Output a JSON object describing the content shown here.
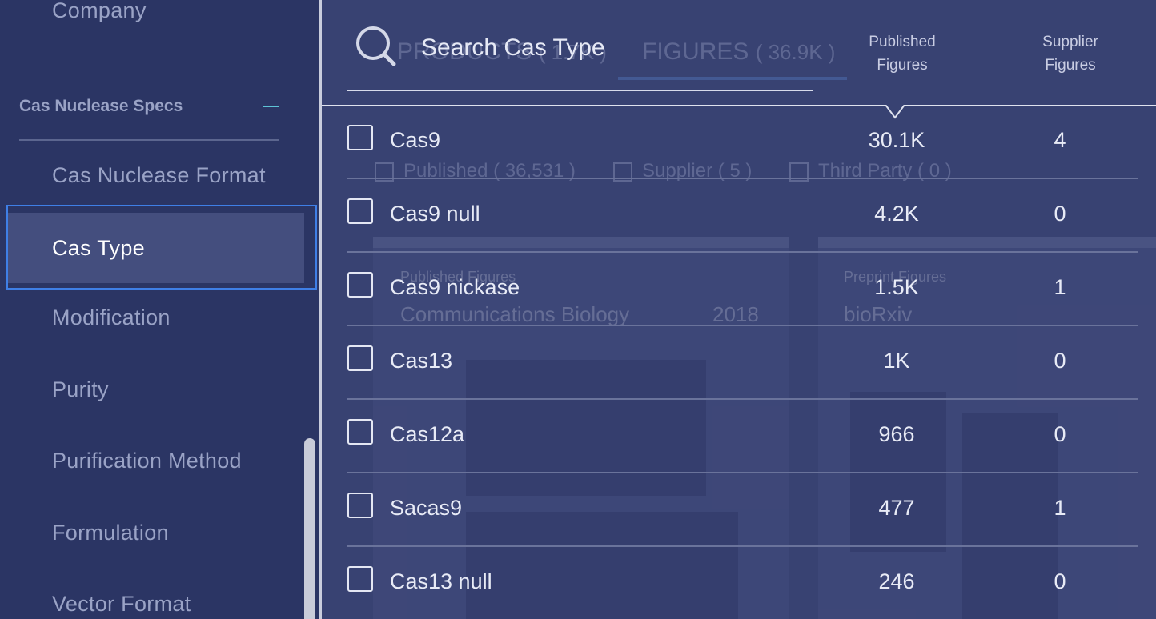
{
  "sidebar": {
    "company_label": "Company",
    "section_title": "Cas Nuclease Specs",
    "items": [
      {
        "label": "Cas Nuclease Format"
      },
      {
        "label": "Cas Type"
      },
      {
        "label": "Modification"
      },
      {
        "label": "Purity"
      },
      {
        "label": "Purification Method"
      },
      {
        "label": "Formulation"
      },
      {
        "label": "Vector Format"
      }
    ]
  },
  "search": {
    "placeholder": "Search Cas Type",
    "published_header_line1": "Published",
    "published_header_line2": "Figures",
    "supplier_header_line1": "Supplier",
    "supplier_header_line2": "Figures"
  },
  "options": [
    {
      "name": "Cas9",
      "published": "30.1K",
      "supplier": "4"
    },
    {
      "name": "Cas9 null",
      "published": "4.2K",
      "supplier": "0"
    },
    {
      "name": "Cas9 nickase",
      "published": "1.5K",
      "supplier": "1"
    },
    {
      "name": "Cas13",
      "published": "1K",
      "supplier": "0"
    },
    {
      "name": "Cas12a",
      "published": "966",
      "supplier": "0"
    },
    {
      "name": "Sacas9",
      "published": "477",
      "supplier": "1"
    },
    {
      "name": "Cas13 null",
      "published": "246",
      "supplier": "0"
    }
  ],
  "background": {
    "tab_products": "PRODUCTS",
    "tab_products_count": "( 1.7K )",
    "tab_figures": "FIGURES",
    "tab_figures_count": "( 36.9K )",
    "filter_published": "Published",
    "filter_published_count": "( 36,531 )",
    "filter_supplier": "Supplier",
    "filter_supplier_count": "( 5 )",
    "filter_third_party": "Third Party",
    "filter_third_party_count": "( 0 )",
    "card1_tag": "Published Figures",
    "card1_journal": "Communications Biology",
    "card1_year": "2018",
    "card2_tag": "Preprint Figures",
    "card2_journal": "bioRxiv"
  },
  "colors": {
    "sidebar_bg": "#2b3564",
    "overlay_bg": "#384272",
    "active_border": "#3f7fe6",
    "collapse_accent": "#5ec3d6"
  }
}
